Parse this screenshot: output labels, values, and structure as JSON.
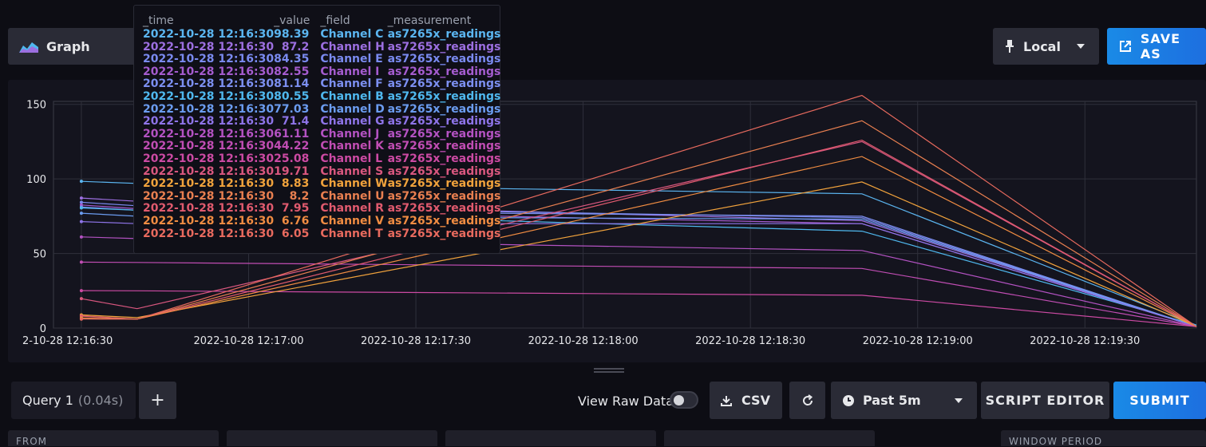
{
  "toolbar": {
    "graph_label": "Graph",
    "local_label": "Local",
    "save_as_label": "SAVE AS"
  },
  "tooltip": {
    "headers": [
      "_time",
      "_value",
      "_field",
      "_measurement"
    ],
    "rows": [
      {
        "time": "2022-10-28 12:16:30",
        "value": "98.39",
        "field": "Channel C",
        "measurement": "as7265x_readings",
        "color": "#5bb5f0"
      },
      {
        "time": "2022-10-28 12:16:30",
        "value": "87.2",
        "field": "Channel H",
        "measurement": "as7265x_readings",
        "color": "#9c6fe0"
      },
      {
        "time": "2022-10-28 12:16:30",
        "value": "84.35",
        "field": "Channel E",
        "measurement": "as7265x_readings",
        "color": "#7a8af0"
      },
      {
        "time": "2022-10-28 12:16:30",
        "value": "82.55",
        "field": "Channel I",
        "measurement": "as7265x_readings",
        "color": "#a55ccf"
      },
      {
        "time": "2022-10-28 12:16:30",
        "value": "81.14",
        "field": "Channel F",
        "measurement": "as7265x_readings",
        "color": "#7c8ff0"
      },
      {
        "time": "2022-10-28 12:16:30",
        "value": "80.55",
        "field": "Channel B",
        "measurement": "as7265x_readings",
        "color": "#4fb8ee"
      },
      {
        "time": "2022-10-28 12:16:30",
        "value": "77.03",
        "field": "Channel D",
        "measurement": "as7265x_readings",
        "color": "#6b9cf0"
      },
      {
        "time": "2022-10-28 12:16:30",
        "value": "71.4",
        "field": "Channel G",
        "measurement": "as7265x_readings",
        "color": "#8e74e8"
      },
      {
        "time": "2022-10-28 12:16:30",
        "value": "61.11",
        "field": "Channel J",
        "measurement": "as7265x_readings",
        "color": "#b352c2"
      },
      {
        "time": "2022-10-28 12:16:30",
        "value": "44.22",
        "field": "Channel K",
        "measurement": "as7265x_readings",
        "color": "#c04db3"
      },
      {
        "time": "2022-10-28 12:16:30",
        "value": "25.08",
        "field": "Channel L",
        "measurement": "as7265x_readings",
        "color": "#cc4aa3"
      },
      {
        "time": "2022-10-28 12:16:30",
        "value": "19.71",
        "field": "Channel S",
        "measurement": "as7265x_readings",
        "color": "#d9577f"
      },
      {
        "time": "2022-10-28 12:16:30",
        "value": "8.83",
        "field": "Channel W",
        "measurement": "as7265x_readings",
        "color": "#f0a23c"
      },
      {
        "time": "2022-10-28 12:16:30",
        "value": "8.2",
        "field": "Channel U",
        "measurement": "as7265x_readings",
        "color": "#e87f50"
      },
      {
        "time": "2022-10-28 12:16:30",
        "value": "7.95",
        "field": "Channel R",
        "measurement": "as7265x_readings",
        "color": "#e05a6e"
      },
      {
        "time": "2022-10-28 12:16:30",
        "value": "6.76",
        "field": "Channel V",
        "measurement": "as7265x_readings",
        "color": "#f08c42"
      },
      {
        "time": "2022-10-28 12:16:30",
        "value": "6.05",
        "field": "Channel T",
        "measurement": "as7265x_readings",
        "color": "#e86a5e"
      }
    ]
  },
  "chart_data": {
    "type": "line",
    "x_labels": [
      "2-10-28 12:16:30",
      "2022-10-28 12:17:00",
      "2022-10-28 12:17:30",
      "2022-10-28 12:18:00",
      "2022-10-28 12:18:30",
      "2022-10-28 12:19:00",
      "2022-10-28 12:19:30"
    ],
    "x_tick_seconds": [
      0,
      30,
      60,
      90,
      120,
      150,
      180
    ],
    "xlim_seconds": [
      -5,
      200
    ],
    "ylim": [
      0,
      152
    ],
    "y_ticks": [
      0,
      50,
      100,
      150
    ],
    "grid": true,
    "x_seconds": [
      0,
      10,
      140,
      200
    ],
    "series": [
      {
        "name": "Channel C",
        "color": "#5bb5f0",
        "values": [
          98.39,
          97,
          90,
          2
        ]
      },
      {
        "name": "Channel H",
        "color": "#9c6fe0",
        "values": [
          87.2,
          85,
          72,
          1
        ]
      },
      {
        "name": "Channel E",
        "color": "#7a8af0",
        "values": [
          84.35,
          82,
          74,
          1
        ]
      },
      {
        "name": "Channel I",
        "color": "#a55ccf",
        "values": [
          82.55,
          80,
          70,
          1
        ]
      },
      {
        "name": "Channel F",
        "color": "#7c8ff0",
        "values": [
          81.14,
          79,
          75,
          1
        ]
      },
      {
        "name": "Channel B",
        "color": "#4fb8ee",
        "values": [
          80.55,
          79,
          65,
          2
        ]
      },
      {
        "name": "Channel D",
        "color": "#6b9cf0",
        "values": [
          77.03,
          75,
          73,
          1
        ]
      },
      {
        "name": "Channel G",
        "color": "#8e74e8",
        "values": [
          71.4,
          70,
          70,
          1
        ]
      },
      {
        "name": "Channel J",
        "color": "#b352c2",
        "values": [
          61.11,
          60,
          52,
          1
        ]
      },
      {
        "name": "Channel K",
        "color": "#c04db3",
        "values": [
          44.22,
          44,
          40,
          1
        ]
      },
      {
        "name": "Channel L",
        "color": "#cc4aa3",
        "values": [
          25.08,
          25,
          22,
          1
        ]
      },
      {
        "name": "Channel S",
        "color": "#d9577f",
        "values": [
          19.71,
          13,
          125,
          1
        ]
      },
      {
        "name": "Channel W",
        "color": "#f0a23c",
        "values": [
          8.83,
          7,
          98,
          1
        ]
      },
      {
        "name": "Channel U",
        "color": "#e87f50",
        "values": [
          8.2,
          6,
          139,
          1
        ]
      },
      {
        "name": "Channel R",
        "color": "#e05a6e",
        "values": [
          7.95,
          6,
          126,
          1
        ]
      },
      {
        "name": "Channel V",
        "color": "#f08c42",
        "values": [
          6.76,
          6,
          115,
          1
        ]
      },
      {
        "name": "Channel T",
        "color": "#e86a5e",
        "values": [
          6.05,
          6,
          156,
          1
        ]
      }
    ]
  },
  "query": {
    "tab_label": "Query 1",
    "tab_time": "(0.04s)",
    "add_label": "+",
    "raw_data_label": "View Raw Data",
    "csv_label": "CSV",
    "range_label": "Past 5m",
    "script_editor_label": "SCRIPT EDITOR",
    "submit_label": "SUBMIT"
  },
  "builder": {
    "from_label": "FROM",
    "window_period_label": "WINDOW PERIOD"
  }
}
